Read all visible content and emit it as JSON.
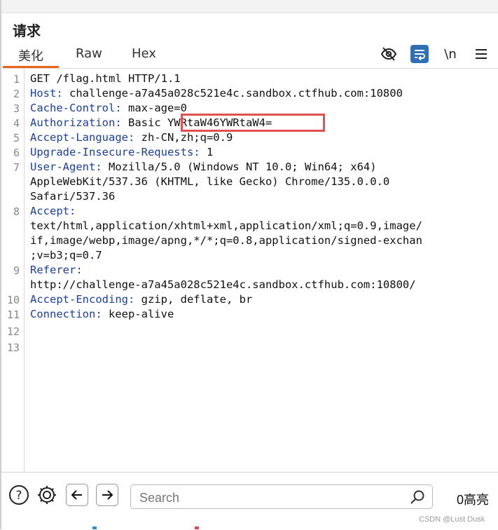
{
  "panel": {
    "title": "请求"
  },
  "tabs": [
    {
      "label": "美化",
      "active": true
    },
    {
      "label": "Raw",
      "active": false
    },
    {
      "label": "Hex",
      "active": false
    }
  ],
  "toolbar_icons": [
    "eye-off-icon",
    "wrap-lines-icon",
    "newline-icon",
    "menu-icon"
  ],
  "request_lines": [
    {
      "n": "1",
      "parts": [
        "GET /flag.html HTTP/1.1"
      ]
    },
    {
      "n": "2",
      "key": "Host:",
      "value": " challenge-a7a45a028c521e4c.sandbox.ctfhub.com:10800"
    },
    {
      "n": "3",
      "key": "Cache-Control:",
      "value": " max-age=0"
    },
    {
      "n": "4",
      "key": "Authorization:",
      "value": " Basic YWRtaW46YWRtaW4="
    },
    {
      "n": "5",
      "key": "Accept-Language:",
      "value": " zh-CN,zh;q=0.9"
    },
    {
      "n": "6",
      "key": "Upgrade-Insecure-Requests:",
      "value": " 1"
    },
    {
      "n": "7",
      "key": "User-Agent:",
      "value": " Mozilla/5.0 (Windows NT 10.0; Win64; x64)"
    },
    {
      "n": "",
      "cont": "AppleWebKit/537.36 (KHTML, like Gecko) Chrome/135.0.0.0"
    },
    {
      "n": "",
      "cont": "Safari/537.36"
    },
    {
      "n": "8",
      "key": "Accept:",
      "value": ""
    },
    {
      "n": "",
      "cont": "text/html,application/xhtml+xml,application/xml;q=0.9,image/"
    },
    {
      "n": "",
      "cont": "if,image/webp,image/apng,*/*;q=0.8,application/signed-exchan"
    },
    {
      "n": "",
      "cont": ";v=b3;q=0.7"
    },
    {
      "n": "9",
      "key": "Referer:",
      "value": ""
    },
    {
      "n": "",
      "cont": "http://challenge-a7a45a028c521e4c.sandbox.ctfhub.com:10800/"
    },
    {
      "n": "10",
      "key": "Accept-Encoding:",
      "value": " gzip, deflate, br"
    },
    {
      "n": "11",
      "key": "Connection:",
      "value": " keep-alive"
    },
    {
      "n": "12",
      "cont": ""
    },
    {
      "n": "13",
      "cont": ""
    }
  ],
  "search": {
    "placeholder": "Search",
    "value": ""
  },
  "match_count": "0高亮",
  "watermark": "CSDN @Lust Dusk",
  "colors": {
    "accent_tab": "#e8651a",
    "header_key": "#1a3fa0",
    "highlight_box": "#e35050",
    "active_icon": "#2f6fb5"
  }
}
